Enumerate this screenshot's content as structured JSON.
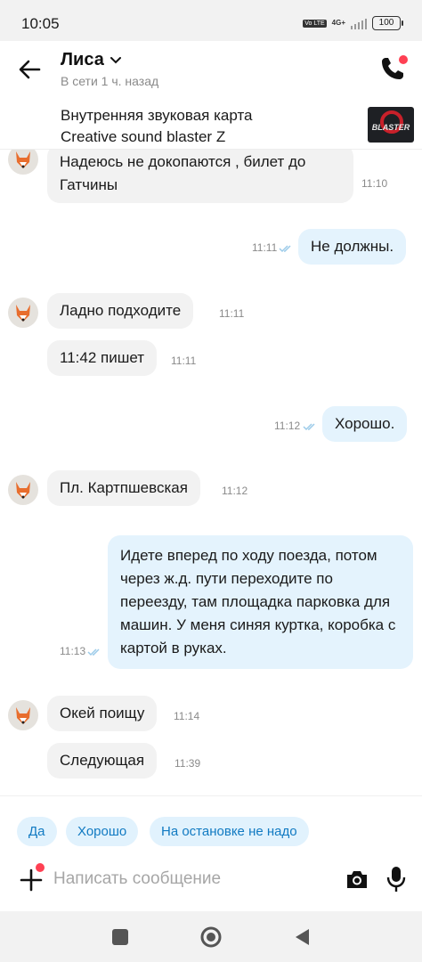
{
  "status_bar": {
    "time": "10:05",
    "volte": "Vo LTE",
    "network": "4G+",
    "battery": "100"
  },
  "header": {
    "name": "Лиса",
    "status": "В сети 1 ч. назад"
  },
  "product": {
    "title": "Внутренняя звуковая карта\nCreative sound blaster Z",
    "thumb_text": "BLASTER"
  },
  "messages": [
    {
      "dir": "in",
      "text": "Надеюсь не докопаются , билет до Гатчины",
      "time": "11:10"
    },
    {
      "dir": "out",
      "text": "Не должны.",
      "time": "11:11"
    },
    {
      "dir": "in",
      "text": "Ладно подходите",
      "time": "11:11"
    },
    {
      "dir": "in",
      "text": "11:42 пишет",
      "time": "11:11"
    },
    {
      "dir": "out",
      "text": "Хорошо.",
      "time": "11:12"
    },
    {
      "dir": "in",
      "text": "Пл. Картпшевская",
      "time": "11:12"
    },
    {
      "dir": "out",
      "text": "Идете вперед по ходу поезда, потом через ж.д. пути переходите по переезду, там площадка парковка для машин.  У меня синяя куртка, коробка с картой в руках.",
      "time": "11:13"
    },
    {
      "dir": "in",
      "text": "Окей поищу",
      "time": "11:14"
    },
    {
      "dir": "in",
      "text": "Следующая",
      "time": "11:39"
    }
  ],
  "quick_replies": [
    "Да",
    "Хорошо",
    "На остановке не надо"
  ],
  "composer": {
    "placeholder": "Написать сообщение"
  },
  "colors": {
    "accent": "#117ac2",
    "chip_bg": "#e1f2fd",
    "out_bubble": "#e4f3fd",
    "in_bubble": "#f2f2f2",
    "notification_dot": "#ff4053"
  }
}
